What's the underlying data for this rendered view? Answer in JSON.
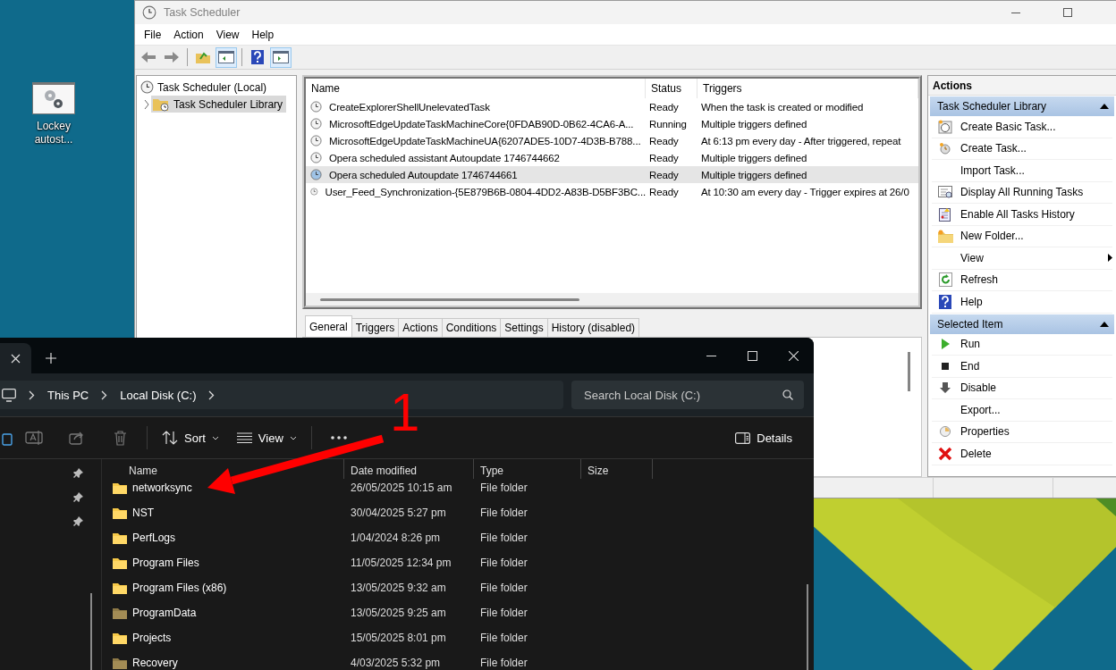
{
  "desktop": {
    "icons": [
      {
        "label": "Lockey autost..."
      }
    ]
  },
  "task_scheduler": {
    "title": "Task Scheduler",
    "menu": [
      "File",
      "Action",
      "View",
      "Help"
    ],
    "toolbar": [
      {
        "pressed": false
      },
      {
        "pressed": false
      },
      {
        "pressed": false
      },
      {
        "pressed": true
      },
      {
        "pressed": false
      },
      {
        "pressed": true
      }
    ],
    "tree": [
      {
        "label": "Task Scheduler (Local)",
        "selected": false,
        "children": [
          {
            "label": "Task Scheduler Library",
            "selected": true,
            "expanded": false
          }
        ]
      }
    ],
    "tasks": {
      "columns": [
        "Name",
        "Status",
        "Triggers"
      ],
      "rows": [
        {
          "name": "CreateExplorerShellUnelevatedTask",
          "status": "Ready",
          "triggers": "When the task is created or modified",
          "selected": false
        },
        {
          "name": "MicrosoftEdgeUpdateTaskMachineCore{0FDAB90D-0B62-4CA6-A...",
          "status": "Running",
          "triggers": "Multiple triggers defined",
          "selected": false
        },
        {
          "name": "MicrosoftEdgeUpdateTaskMachineUA{6207ADE5-10D7-4D3B-B788...",
          "status": "Ready",
          "triggers": "At 6:13 pm every day - After triggered, repeat",
          "selected": false
        },
        {
          "name": "Opera scheduled assistant Autoupdate 1746744662",
          "status": "Ready",
          "triggers": "Multiple triggers defined",
          "selected": false
        },
        {
          "name": "Opera scheduled Autoupdate 1746744661",
          "status": "Ready",
          "triggers": "Multiple triggers defined",
          "selected": true
        },
        {
          "name": "User_Feed_Synchronization-{5E879B6B-0804-4DD2-A83B-D5BF3BC...",
          "status": "Ready",
          "triggers": "At 10:30 am every day - Trigger expires at 26/0",
          "selected": false
        }
      ]
    },
    "detail_tabs": [
      {
        "label": "General",
        "selected": true
      },
      {
        "label": "Triggers",
        "selected": false
      },
      {
        "label": "Actions",
        "selected": false
      },
      {
        "label": "Conditions",
        "selected": false
      },
      {
        "label": "Settings",
        "selected": false
      },
      {
        "label": "History (disabled)",
        "selected": false
      }
    ],
    "actions": {
      "title": "Actions",
      "sections": [
        {
          "title": "Task Scheduler Library",
          "expanded": true,
          "items": [
            {
              "label": "Create Basic Task...",
              "submenu": false
            },
            {
              "label": "Create Task...",
              "submenu": false
            },
            {
              "label": "Import Task...",
              "submenu": false
            },
            {
              "label": "Display All Running Tasks",
              "submenu": false
            },
            {
              "label": "Enable All Tasks History",
              "submenu": false
            },
            {
              "label": "New Folder...",
              "submenu": false
            },
            {
              "label": "View",
              "submenu": true
            },
            {
              "label": "Refresh",
              "submenu": false
            },
            {
              "label": "Help",
              "submenu": false
            }
          ]
        },
        {
          "title": "Selected Item",
          "expanded": true,
          "items": [
            {
              "label": "Run",
              "submenu": false
            },
            {
              "label": "End",
              "submenu": false
            },
            {
              "label": "Disable",
              "submenu": false
            },
            {
              "label": "Export...",
              "submenu": false
            },
            {
              "label": "Properties",
              "submenu": false
            },
            {
              "label": "Delete",
              "submenu": false
            }
          ]
        }
      ]
    }
  },
  "explorer": {
    "breadcrumb": [
      "This PC",
      "Local Disk (C:)"
    ],
    "search": {
      "placeholder": "Search Local Disk (C:)"
    },
    "commands": {
      "sort": "Sort",
      "view": "View",
      "details": "Details"
    },
    "columns": [
      "Name",
      "Date modified",
      "Type",
      "Size"
    ],
    "rows": [
      {
        "name": "networksync",
        "date": "26/05/2025 10:15 am",
        "type": "File folder",
        "hidden": false
      },
      {
        "name": "NST",
        "date": "30/04/2025 5:27 pm",
        "type": "File folder",
        "hidden": false
      },
      {
        "name": "PerfLogs",
        "date": "1/04/2024 8:26 pm",
        "type": "File folder",
        "hidden": false
      },
      {
        "name": "Program Files",
        "date": "11/05/2025 12:34 pm",
        "type": "File folder",
        "hidden": false
      },
      {
        "name": "Program Files (x86)",
        "date": "13/05/2025 9:32 am",
        "type": "File folder",
        "hidden": false
      },
      {
        "name": "ProgramData",
        "date": "13/05/2025 9:25 am",
        "type": "File folder",
        "hidden": true
      },
      {
        "name": "Projects",
        "date": "15/05/2025 8:01 pm",
        "type": "File folder",
        "hidden": false
      },
      {
        "name": "Recovery",
        "date": "4/03/2025 5:32 pm",
        "type": "File folder",
        "hidden": true
      }
    ]
  },
  "annotation": {
    "label": "1"
  }
}
